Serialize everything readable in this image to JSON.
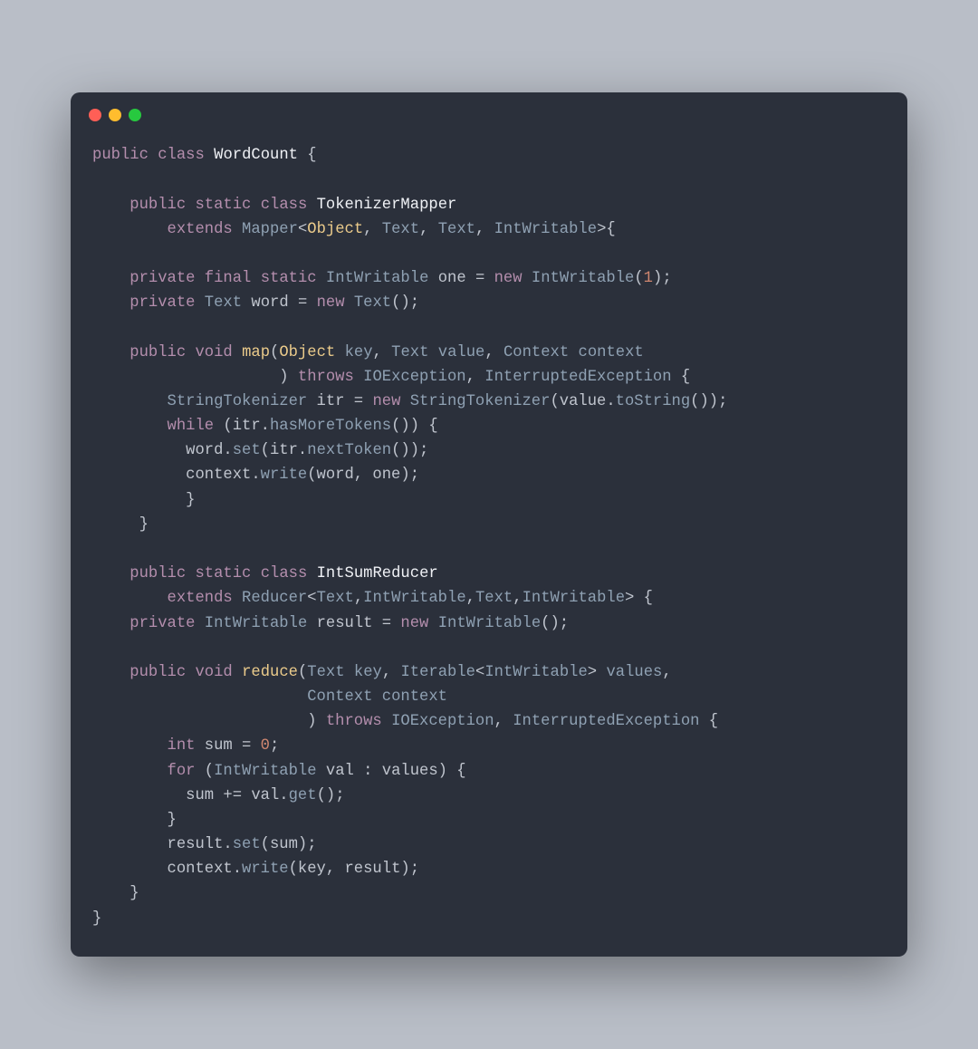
{
  "window": {
    "traffic_lights": [
      "close",
      "minimize",
      "zoom"
    ]
  },
  "code": {
    "lines": [
      [
        [
          "kw",
          "public"
        ],
        [
          "pun",
          " "
        ],
        [
          "kw",
          "class"
        ],
        [
          "pun",
          " "
        ],
        [
          "wht",
          "WordCount"
        ],
        [
          "pun",
          " {"
        ]
      ],
      [],
      [
        [
          "pun",
          "    "
        ],
        [
          "kw",
          "public"
        ],
        [
          "pun",
          " "
        ],
        [
          "kw",
          "static"
        ],
        [
          "pun",
          " "
        ],
        [
          "kw",
          "class"
        ],
        [
          "pun",
          " "
        ],
        [
          "wht",
          "TokenizerMapper"
        ]
      ],
      [
        [
          "pun",
          "        "
        ],
        [
          "kw",
          "extends"
        ],
        [
          "pun",
          " "
        ],
        [
          "typ",
          "Mapper"
        ],
        [
          "pun",
          "<"
        ],
        [
          "cls",
          "Object"
        ],
        [
          "pun",
          ", "
        ],
        [
          "typ",
          "Text"
        ],
        [
          "pun",
          ", "
        ],
        [
          "typ",
          "Text"
        ],
        [
          "pun",
          ", "
        ],
        [
          "typ",
          "IntWritable"
        ],
        [
          "pun",
          ">{"
        ]
      ],
      [],
      [
        [
          "pun",
          "    "
        ],
        [
          "kw",
          "private"
        ],
        [
          "pun",
          " "
        ],
        [
          "kw",
          "final"
        ],
        [
          "pun",
          " "
        ],
        [
          "kw",
          "static"
        ],
        [
          "pun",
          " "
        ],
        [
          "typ",
          "IntWritable"
        ],
        [
          "pun",
          " one = "
        ],
        [
          "kw",
          "new"
        ],
        [
          "pun",
          " "
        ],
        [
          "typ",
          "IntWritable"
        ],
        [
          "pun",
          "("
        ],
        [
          "num",
          "1"
        ],
        [
          "pun",
          ");"
        ]
      ],
      [
        [
          "pun",
          "    "
        ],
        [
          "kw",
          "private"
        ],
        [
          "pun",
          " "
        ],
        [
          "typ",
          "Text"
        ],
        [
          "pun",
          " word = "
        ],
        [
          "kw",
          "new"
        ],
        [
          "pun",
          " "
        ],
        [
          "typ",
          "Text"
        ],
        [
          "pun",
          "();"
        ]
      ],
      [],
      [
        [
          "pun",
          "    "
        ],
        [
          "kw",
          "public"
        ],
        [
          "pun",
          " "
        ],
        [
          "kw",
          "void"
        ],
        [
          "pun",
          " "
        ],
        [
          "fn",
          "map"
        ],
        [
          "pun",
          "("
        ],
        [
          "cls",
          "Object"
        ],
        [
          "pun",
          " "
        ],
        [
          "typ",
          "key"
        ],
        [
          "pun",
          ", "
        ],
        [
          "typ",
          "Text"
        ],
        [
          "pun",
          " "
        ],
        [
          "typ",
          "value"
        ],
        [
          "pun",
          ", "
        ],
        [
          "typ",
          "Context"
        ],
        [
          "pun",
          " "
        ],
        [
          "typ",
          "context"
        ]
      ],
      [
        [
          "pun",
          "                    ) "
        ],
        [
          "kw",
          "throws"
        ],
        [
          "pun",
          " "
        ],
        [
          "typ",
          "IOException"
        ],
        [
          "pun",
          ", "
        ],
        [
          "typ",
          "InterruptedException"
        ],
        [
          "pun",
          " {"
        ]
      ],
      [
        [
          "pun",
          "        "
        ],
        [
          "typ",
          "StringTokenizer"
        ],
        [
          "pun",
          " itr = "
        ],
        [
          "kw",
          "new"
        ],
        [
          "pun",
          " "
        ],
        [
          "typ",
          "StringTokenizer"
        ],
        [
          "pun",
          "(value."
        ],
        [
          "typ",
          "toString"
        ],
        [
          "pun",
          "());"
        ]
      ],
      [
        [
          "pun",
          "        "
        ],
        [
          "kw",
          "while"
        ],
        [
          "pun",
          " (itr."
        ],
        [
          "typ",
          "hasMoreTokens"
        ],
        [
          "pun",
          "()) {"
        ]
      ],
      [
        [
          "pun",
          "          word."
        ],
        [
          "typ",
          "set"
        ],
        [
          "pun",
          "(itr."
        ],
        [
          "typ",
          "nextToken"
        ],
        [
          "pun",
          "());"
        ]
      ],
      [
        [
          "pun",
          "          context."
        ],
        [
          "typ",
          "write"
        ],
        [
          "pun",
          "(word, one);"
        ]
      ],
      [
        [
          "pun",
          "          }"
        ]
      ],
      [
        [
          "pun",
          "     }"
        ]
      ],
      [],
      [
        [
          "pun",
          "    "
        ],
        [
          "kw",
          "public"
        ],
        [
          "pun",
          " "
        ],
        [
          "kw",
          "static"
        ],
        [
          "pun",
          " "
        ],
        [
          "kw",
          "class"
        ],
        [
          "pun",
          " "
        ],
        [
          "wht",
          "IntSumReducer"
        ]
      ],
      [
        [
          "pun",
          "        "
        ],
        [
          "kw",
          "extends"
        ],
        [
          "pun",
          " "
        ],
        [
          "typ",
          "Reducer"
        ],
        [
          "pun",
          "<"
        ],
        [
          "typ",
          "Text"
        ],
        [
          "pun",
          ","
        ],
        [
          "typ",
          "IntWritable"
        ],
        [
          "pun",
          ","
        ],
        [
          "typ",
          "Text"
        ],
        [
          "pun",
          ","
        ],
        [
          "typ",
          "IntWritable"
        ],
        [
          "pun",
          "> {"
        ]
      ],
      [
        [
          "pun",
          "    "
        ],
        [
          "kw",
          "private"
        ],
        [
          "pun",
          " "
        ],
        [
          "typ",
          "IntWritable"
        ],
        [
          "pun",
          " result = "
        ],
        [
          "kw",
          "new"
        ],
        [
          "pun",
          " "
        ],
        [
          "typ",
          "IntWritable"
        ],
        [
          "pun",
          "();"
        ]
      ],
      [],
      [
        [
          "pun",
          "    "
        ],
        [
          "kw",
          "public"
        ],
        [
          "pun",
          " "
        ],
        [
          "kw",
          "void"
        ],
        [
          "pun",
          " "
        ],
        [
          "fn",
          "reduce"
        ],
        [
          "pun",
          "("
        ],
        [
          "typ",
          "Text"
        ],
        [
          "pun",
          " "
        ],
        [
          "typ",
          "key"
        ],
        [
          "pun",
          ", "
        ],
        [
          "typ",
          "Iterable"
        ],
        [
          "pun",
          "<"
        ],
        [
          "typ",
          "IntWritable"
        ],
        [
          "pun",
          "> "
        ],
        [
          "typ",
          "values"
        ],
        [
          "pun",
          ","
        ]
      ],
      [
        [
          "pun",
          "                       "
        ],
        [
          "typ",
          "Context"
        ],
        [
          "pun",
          " "
        ],
        [
          "typ",
          "context"
        ]
      ],
      [
        [
          "pun",
          "                       ) "
        ],
        [
          "kw",
          "throws"
        ],
        [
          "pun",
          " "
        ],
        [
          "typ",
          "IOException"
        ],
        [
          "pun",
          ", "
        ],
        [
          "typ",
          "InterruptedException"
        ],
        [
          "pun",
          " {"
        ]
      ],
      [
        [
          "pun",
          "        "
        ],
        [
          "kw",
          "int"
        ],
        [
          "pun",
          " sum = "
        ],
        [
          "num",
          "0"
        ],
        [
          "pun",
          ";"
        ]
      ],
      [
        [
          "pun",
          "        "
        ],
        [
          "kw",
          "for"
        ],
        [
          "pun",
          " ("
        ],
        [
          "typ",
          "IntWritable"
        ],
        [
          "pun",
          " val : values) {"
        ]
      ],
      [
        [
          "pun",
          "          sum += val."
        ],
        [
          "typ",
          "get"
        ],
        [
          "pun",
          "();"
        ]
      ],
      [
        [
          "pun",
          "        }"
        ]
      ],
      [
        [
          "pun",
          "        result."
        ],
        [
          "typ",
          "set"
        ],
        [
          "pun",
          "(sum);"
        ]
      ],
      [
        [
          "pun",
          "        context."
        ],
        [
          "typ",
          "write"
        ],
        [
          "pun",
          "(key, result);"
        ]
      ],
      [
        [
          "pun",
          "    }"
        ]
      ],
      [
        [
          "pun",
          "}"
        ]
      ]
    ]
  }
}
